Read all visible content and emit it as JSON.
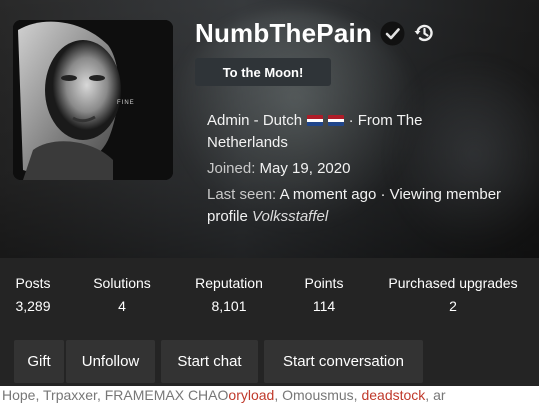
{
  "profile": {
    "username": "NumbThePain",
    "user_title": "To the Moon!",
    "role_text": "Admin - Dutch",
    "from_text": "· From The Netherlands",
    "joined_label": "Joined:",
    "joined_date": "May 19, 2020",
    "last_seen_label": "Last seen:",
    "last_seen_text": "A moment ago · Viewing member profile",
    "viewing_member": "Volksstaffel",
    "avatar_caption": "FINE"
  },
  "icons": {
    "verified": "verified-check-icon",
    "history": "history-icon"
  },
  "colors": {
    "card_bg": "#242424",
    "button_bg": "#333333",
    "title_badge_bg": "#2f3438",
    "flag_red": "#ae1c28",
    "flag_white": "#ffffff",
    "flag_blue": "#21468b"
  },
  "stats": [
    {
      "label": "Posts",
      "value": "3,289"
    },
    {
      "label": "Solutions",
      "value": "4"
    },
    {
      "label": "Reputation",
      "value": "8,101"
    },
    {
      "label": "Points",
      "value": "114"
    },
    {
      "label": "Purchased upgrades",
      "value": "2"
    }
  ],
  "actions": {
    "gift": "Gift",
    "unfollow": "Unfollow",
    "start_chat": "Start chat",
    "start_conversation": "Start conversation"
  },
  "background_text": {
    "part1": "Hope, Trpaxxer, FRAMEMAX CHAO",
    "part2": "oryload",
    "part3": ", Omousmus, ",
    "part4": "deadstock",
    "part5": ", ar"
  }
}
